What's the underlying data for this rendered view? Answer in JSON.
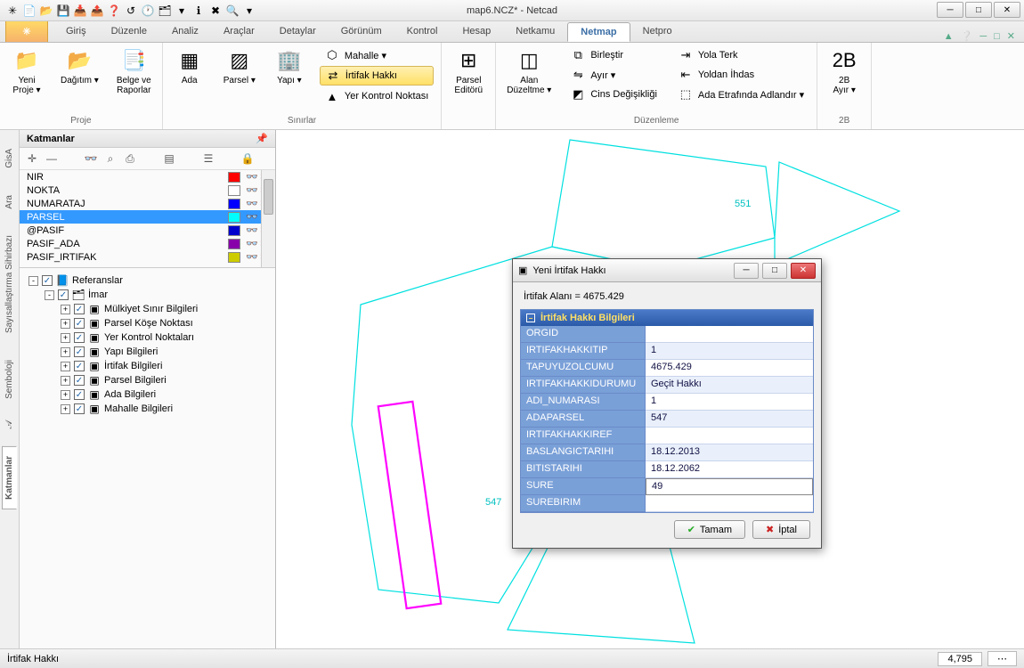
{
  "window": {
    "title": "map6.NCZ* - Netcad"
  },
  "win_controls": {
    "min": "─",
    "max": "□",
    "close": "✕"
  },
  "qat": [
    "✳",
    "📄",
    "📂",
    "💾",
    "📥",
    "📤",
    "❓",
    "↺",
    "🕐",
    "🗂",
    "▾",
    "ℹ",
    "✖",
    "🔍",
    "▾"
  ],
  "tabs": [
    "Giriş",
    "Düzenle",
    "Analiz",
    "Araçlar",
    "Detaylar",
    "Görünüm",
    "Kontrol",
    "Hesap",
    "Netkamu",
    "Netmap",
    "Netpro"
  ],
  "active_tab": 9,
  "tab_right_icons": [
    "▲",
    "❔",
    "─",
    "□",
    "✕"
  ],
  "ribbon": {
    "groups": [
      {
        "label": "Proje",
        "big": [
          {
            "icon": "📁",
            "text": "Yeni\nProje",
            "drop": true
          },
          {
            "icon": "📂",
            "text": "Dağıtım",
            "drop": true
          },
          {
            "icon": "📑",
            "text": "Belge ve\nRaporlar"
          }
        ]
      },
      {
        "label": "Sınırlar",
        "big": [
          {
            "icon": "▦",
            "text": "Ada"
          },
          {
            "icon": "▨",
            "text": "Parsel",
            "drop": true
          },
          {
            "icon": "🏢",
            "text": "Yapı",
            "drop": true
          }
        ],
        "small": [
          {
            "icon": "⬡",
            "text": "Mahalle",
            "drop": true
          },
          {
            "icon": "⇄",
            "text": "İrtifak Hakkı",
            "hl": true
          },
          {
            "icon": "▲",
            "text": "Yer Kontrol Noktası"
          }
        ]
      },
      {
        "label": "",
        "big": [
          {
            "icon": "⊞",
            "text": "Parsel\nEditörü"
          }
        ]
      },
      {
        "label": "Düzenleme",
        "big": [
          {
            "icon": "◫",
            "text": "Alan\nDüzeltme",
            "drop": true
          }
        ],
        "small_cols": [
          [
            {
              "icon": "⧉",
              "text": "Birleştir"
            },
            {
              "icon": "⇋",
              "text": "Ayır",
              "drop": true
            },
            {
              "icon": "◩",
              "text": "Cins Değişikliği"
            }
          ],
          [
            {
              "icon": "⇥",
              "text": "Yola Terk"
            },
            {
              "icon": "⇤",
              "text": "Yoldan İhdas"
            },
            {
              "icon": "⬚",
              "text": "Ada Etrafında Adlandır",
              "drop": true
            }
          ]
        ]
      },
      {
        "label": "2B",
        "big": [
          {
            "icon": "2B",
            "text": "2B\nAyır",
            "drop": true
          }
        ]
      }
    ]
  },
  "panel": {
    "title": "Katmanlar",
    "tools": [
      "✛",
      "—",
      "",
      "👓",
      "⌕",
      "⎙",
      "",
      "▤",
      "",
      "☰",
      "",
      "🔒"
    ],
    "layers": [
      {
        "name": "NIR",
        "color": "#ff0000"
      },
      {
        "name": "NOKTA",
        "color": "#ffffff"
      },
      {
        "name": "NUMARATAJ",
        "color": "#0000ff"
      },
      {
        "name": "PARSEL",
        "color": "#00ffff",
        "sel": true
      },
      {
        "name": "@PASIF",
        "color": "#0000cc"
      },
      {
        "name": "PASIF_ADA",
        "color": "#8800aa"
      },
      {
        "name": "PASIF_IRTIFAK",
        "color": "#cccc00"
      }
    ],
    "tree": [
      {
        "d": 0,
        "exp": "-",
        "chk": true,
        "icon": "📘",
        "text": "Referanslar"
      },
      {
        "d": 1,
        "exp": "-",
        "chk": true,
        "icon": "🗂",
        "text": "İmar"
      },
      {
        "d": 2,
        "exp": "+",
        "chk": true,
        "icon": "▣",
        "text": "Mülkiyet Sınır Bilgileri"
      },
      {
        "d": 2,
        "exp": "+",
        "chk": true,
        "icon": "▣",
        "text": "Parsel Köşe Noktası"
      },
      {
        "d": 2,
        "exp": "+",
        "chk": true,
        "icon": "▣",
        "text": "Yer Kontrol Noktaları"
      },
      {
        "d": 2,
        "exp": "+",
        "chk": true,
        "icon": "▣",
        "text": "Yapı Bilgileri"
      },
      {
        "d": 2,
        "exp": "+",
        "chk": true,
        "icon": "▣",
        "text": "İrtifak Bilgileri"
      },
      {
        "d": 2,
        "exp": "+",
        "chk": true,
        "icon": "▣",
        "text": "Parsel Bilgileri"
      },
      {
        "d": 2,
        "exp": "+",
        "chk": true,
        "icon": "▣",
        "text": "Ada Bilgileri"
      },
      {
        "d": 2,
        "exp": "+",
        "chk": true,
        "icon": "▣",
        "text": "Mahalle Bilgileri"
      }
    ]
  },
  "vtabs": [
    "",
    "GisA",
    "",
    "Ara",
    "",
    "Sayısallaştırma Sihirbazı",
    "",
    "Semboloji",
    "𝒜",
    "",
    "Katmanlar",
    ""
  ],
  "active_vtab": 10,
  "map_labels": {
    "a": "551",
    "b": "547"
  },
  "dialog": {
    "title": "Yeni İrtifak Hakkı",
    "info": "İrtifak Alanı = 4675.429",
    "section": "İrtifak Hakkı Bilgileri",
    "rows": [
      {
        "k": "ORGID",
        "v": ""
      },
      {
        "k": "IRTIFAKHAKKITIP",
        "v": "1"
      },
      {
        "k": "TAPUYUZOLCUMU",
        "v": "4675.429"
      },
      {
        "k": "IRTIFAKHAKKIDURUMU",
        "v": "Geçit Hakkı"
      },
      {
        "k": "ADI_NUMARASI",
        "v": "1"
      },
      {
        "k": "ADAPARSEL",
        "v": "547"
      },
      {
        "k": "IRTIFAKHAKKIREF",
        "v": ""
      },
      {
        "k": "BASLANGICTARIHI",
        "v": "18.12.2013"
      },
      {
        "k": "BITISTARIHI",
        "v": "18.12.2062"
      },
      {
        "k": "SURE",
        "v": "49",
        "edit": true
      },
      {
        "k": "SUREBIRIM",
        "v": ""
      }
    ],
    "ok": "Tamam",
    "cancel": "İptal"
  },
  "status": {
    "left": "İrtifak Hakkı",
    "right": "4,795",
    "dots": "⋯"
  }
}
